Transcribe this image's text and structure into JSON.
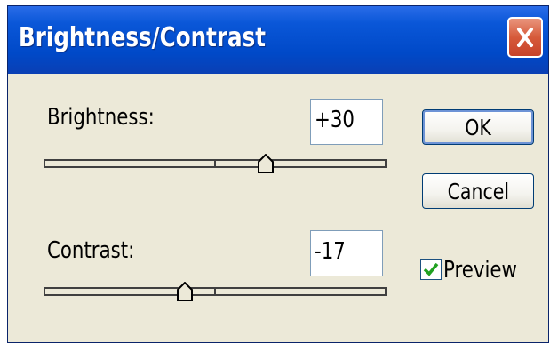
{
  "window": {
    "title": "Brightness/Contrast",
    "close_icon": "close-x-icon"
  },
  "brightness": {
    "label": "Brightness:",
    "value": "+30",
    "slider_level": 0.65
  },
  "contrast": {
    "label": "Contrast:",
    "value": "-17",
    "slider_level": 0.41
  },
  "buttons": {
    "ok_label": "OK",
    "cancel_label": "Cancel"
  },
  "preview": {
    "label": "Preview",
    "checked": true
  },
  "colors": {
    "titlebar": "#0a57d8",
    "close": "#d65a3a",
    "face": "#ece9d8",
    "check": "#21a121"
  }
}
